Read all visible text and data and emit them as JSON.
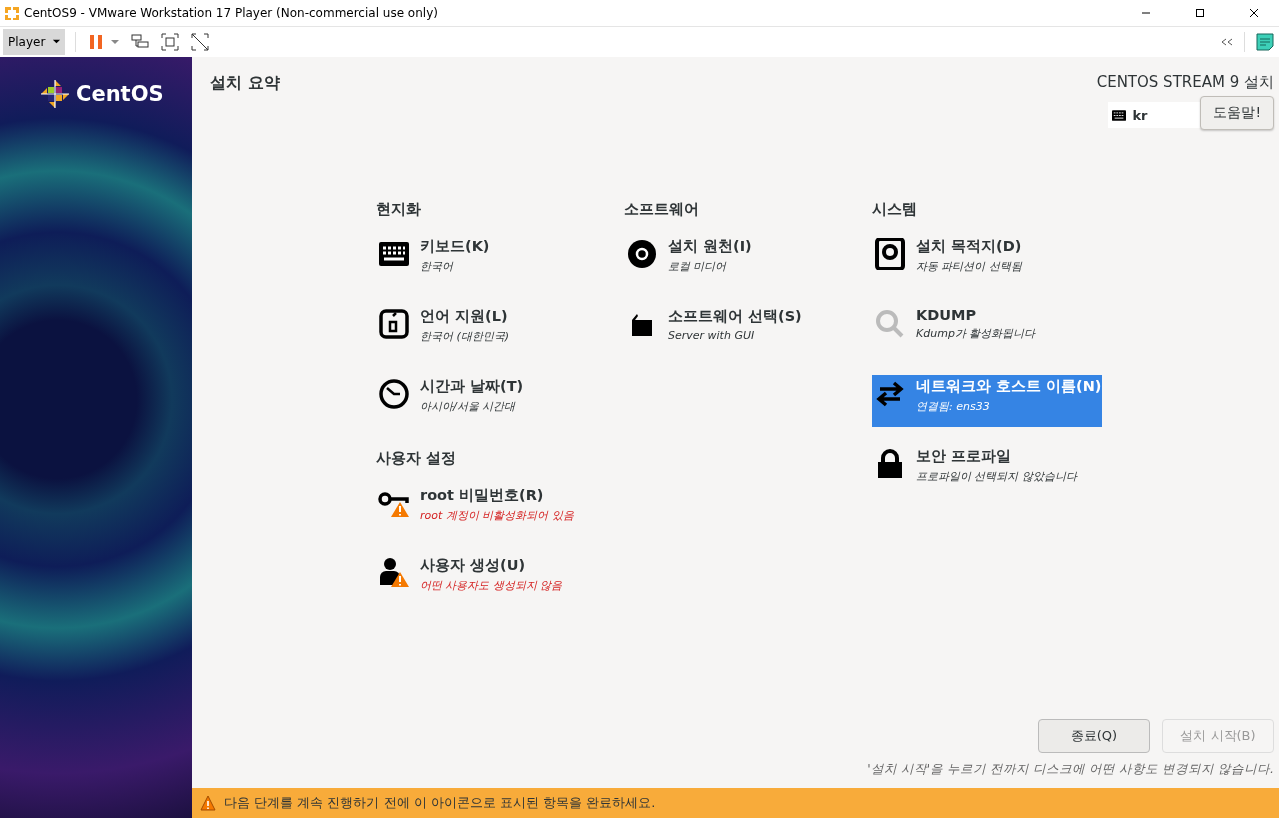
{
  "window": {
    "title": "CentOS9 - VMware Workstation 17 Player (Non-commercial use only)"
  },
  "toolbar": {
    "player_menu": "Player"
  },
  "sidebar": {
    "logo_text": "CentOS"
  },
  "header": {
    "title": "설치 요약",
    "product": "CENTOS STREAM 9 설치",
    "keyboard_layout": "kr",
    "help_button": "도움말!"
  },
  "sections": [
    {
      "title": "현지화",
      "spokes": [
        {
          "kind": "keyboard",
          "title": "키보드(K)",
          "status": "한국어",
          "warning": false,
          "selected": false
        },
        {
          "kind": "language",
          "title": "언어 지원(L)",
          "status": "한국어 (대한민국)",
          "warning": false,
          "selected": false
        },
        {
          "kind": "clock",
          "title": "시간과 날짜(T)",
          "status": "아시아/서울 시간대",
          "warning": false,
          "selected": false
        }
      ]
    },
    {
      "title": "소프트웨어",
      "spokes": [
        {
          "kind": "disc",
          "title": "설치 원천(I)",
          "status": "로컬 미디어",
          "warning": false,
          "selected": false
        },
        {
          "kind": "package",
          "title": "소프트웨어 선택(S)",
          "status": "Server with GUI",
          "warning": false,
          "selected": false
        }
      ]
    },
    {
      "title": "시스템",
      "spokes": [
        {
          "kind": "disk",
          "title": "설치 목적지(D)",
          "status": "자동 파티션이 선택됨",
          "warning": false,
          "selected": false
        },
        {
          "kind": "magnifier",
          "title": "KDUMP",
          "status": "Kdump가 활성화됩니다",
          "warning": false,
          "selected": false
        },
        {
          "kind": "network",
          "title": "네트워크와 호스트 이름(N)",
          "status": "연결됨: ens33",
          "warning": false,
          "selected": true
        },
        {
          "kind": "lock",
          "title": "보안 프로파일",
          "status": "프로파일이 선택되지 않았습니다",
          "warning": false,
          "selected": false
        }
      ]
    },
    {
      "title": "사용자 설정",
      "spokes": [
        {
          "kind": "key",
          "title": "root 비밀번호(R)",
          "status": "root 계정이 비활성화되어 있음",
          "warning": true,
          "selected": false
        },
        {
          "kind": "user",
          "title": "사용자 생성(U)",
          "status": "어떤 사용자도 생성되지 않음",
          "warning": true,
          "selected": false
        }
      ]
    }
  ],
  "buttons": [
    {
      "label": "종료(Q)",
      "disabled": false
    },
    {
      "label": "설치 시작(B)",
      "disabled": true
    }
  ],
  "note": "'설치 시작'을 누르기 전까지 디스크에 어떤 사항도 변경되지 않습니다.",
  "warning_bar": "다음 단계를 계속 진행하기 전에 이 아이콘으로 표시된 항목을 완료하세요."
}
